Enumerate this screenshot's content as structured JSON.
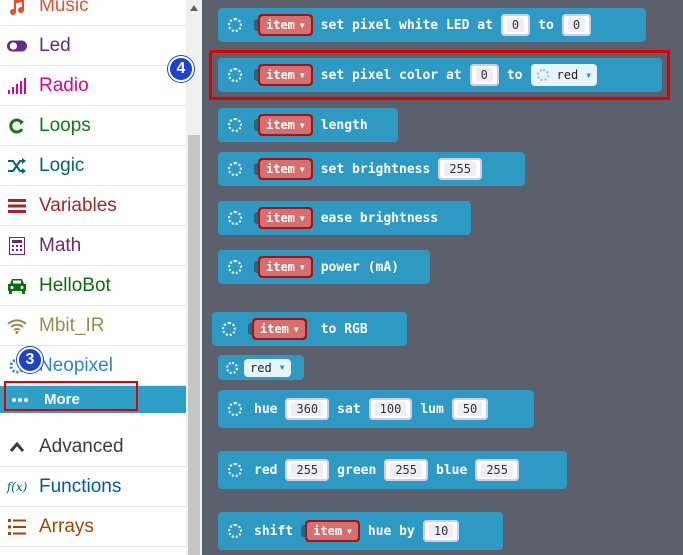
{
  "sidebar": {
    "items": [
      {
        "label": "Music",
        "color": "#e4502e",
        "icon": "music-icon"
      },
      {
        "label": "Led",
        "color": "#5c2d91",
        "icon": "toggle-icon"
      },
      {
        "label": "Radio",
        "color": "#e3008c",
        "icon": "signal-bars-icon"
      },
      {
        "label": "Loops",
        "color": "#107c10",
        "icon": "loop-arrow-icon"
      },
      {
        "label": "Logic",
        "color": "#006970",
        "icon": "shuffle-icon"
      },
      {
        "label": "Variables",
        "color": "#a4262c",
        "icon": "list-lines-icon"
      },
      {
        "label": "Math",
        "color": "#712672",
        "icon": "calculator-icon"
      },
      {
        "label": "HelloBot",
        "color": "#0d6e0d",
        "icon": "car-icon"
      },
      {
        "label": "Mbit_IR",
        "color": "#9a8c50",
        "icon": "wifi-icon"
      },
      {
        "label": "Neopixel",
        "color": "#2c86c8",
        "icon": "gear-icon"
      },
      {
        "label": "More",
        "color": "#ffffff",
        "icon": "dots-icon"
      },
      {
        "label": "Advanced",
        "color": "#3c3c3c",
        "icon": "chevron-up-icon"
      },
      {
        "label": "Functions",
        "color": "#005a9e",
        "icon": "function-icon"
      },
      {
        "label": "Arrays",
        "color": "#a94400",
        "icon": "list-numbered-icon"
      }
    ]
  },
  "callouts": {
    "neopixel": "3",
    "block": "4"
  },
  "blocks": {
    "item_label": "item",
    "b1": {
      "text1": "set pixel white LED at",
      "v1": "0",
      "text2": "to",
      "v2": "0"
    },
    "b2": {
      "text1": "set pixel color at",
      "v1": "0",
      "text2": "to",
      "color": "red"
    },
    "b3": {
      "text1": "length"
    },
    "b4": {
      "text1": "set brightness",
      "v1": "255"
    },
    "b5": {
      "text1": "ease brightness"
    },
    "b6": {
      "text1": "power (mA)"
    },
    "b7": {
      "text1": "to RGB"
    },
    "b8": {
      "color": "red"
    },
    "b9": {
      "t1": "hue",
      "v1": "360",
      "t2": "sat",
      "v2": "100",
      "t3": "lum",
      "v3": "50"
    },
    "b10": {
      "t1": "red",
      "v1": "255",
      "t2": "green",
      "v2": "255",
      "t3": "blue",
      "v3": "255"
    },
    "b11": {
      "t1": "shift",
      "t2": "hue by",
      "v1": "10"
    }
  }
}
